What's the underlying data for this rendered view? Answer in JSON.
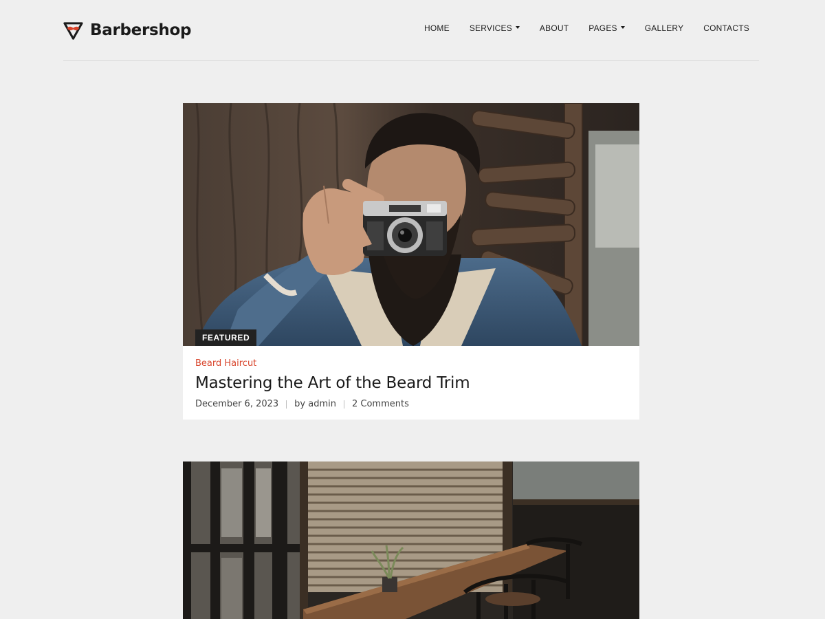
{
  "brand": {
    "name": "Barbershop",
    "accent": "#d8432a"
  },
  "nav": {
    "items": [
      {
        "label": "HOME",
        "has_dropdown": false
      },
      {
        "label": "SERVICES",
        "has_dropdown": true
      },
      {
        "label": "ABOUT",
        "has_dropdown": false
      },
      {
        "label": "PAGES",
        "has_dropdown": true
      },
      {
        "label": "GALLERY",
        "has_dropdown": false
      },
      {
        "label": "CONTACTS",
        "has_dropdown": false
      }
    ]
  },
  "posts": [
    {
      "badge": "FEATURED",
      "category": "Beard Haircut",
      "title": "Mastering the Art of the Beard Trim",
      "date": "December 6, 2023",
      "author": "by admin",
      "comments": "2 Comments",
      "image_icon": "man-with-camera-photo"
    },
    {
      "image_icon": "cafe-interior-photo"
    }
  ]
}
